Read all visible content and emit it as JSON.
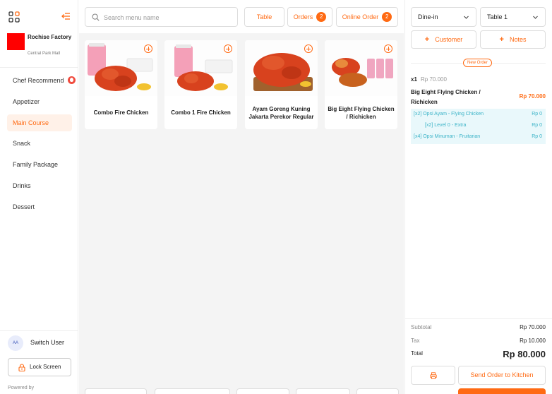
{
  "sidebar": {
    "brand_name": "Rochise Factory",
    "brand_location": "Central Park Mall",
    "categories": [
      {
        "label": "Chef Recommend",
        "active": false,
        "badge": "fire-icon"
      },
      {
        "label": "Appetizer",
        "active": false
      },
      {
        "label": "Main Course",
        "active": true
      },
      {
        "label": "Snack",
        "active": false
      },
      {
        "label": "Family Package",
        "active": false
      },
      {
        "label": "Drinks",
        "active": false
      },
      {
        "label": "Dessert",
        "active": false
      }
    ],
    "user_initials": "AA",
    "switch_user_label": "Switch User",
    "lock_screen_label": "Lock Screen",
    "powered_by": "Powered by"
  },
  "topbar": {
    "search_placeholder": "Search menu name",
    "table_label": "Table",
    "orders_label": "Orders",
    "orders_count": "2",
    "online_order_label": "Online Order",
    "online_order_count": "2"
  },
  "menu": {
    "items": [
      {
        "name": "Combo Fire Chicken"
      },
      {
        "name": "Combo 1 Fire Chicken"
      },
      {
        "name": "Ayam Goreng Kuning Jakarta Perekor Regular"
      },
      {
        "name": "Big Eight Flying Chicken / Richicken"
      }
    ]
  },
  "order": {
    "order_type": "Dine-in",
    "table": "Table 1",
    "customer_label": "Customer",
    "notes_label": "Notes",
    "new_order_label": "New Order",
    "line_items": [
      {
        "qty": "x1",
        "unit_price": "Rp 70.000",
        "name": "Big Eight Flying Chicken / Richicken",
        "total": "Rp 70.000",
        "options": [
          {
            "label": "[x2] Opsi Ayam - Flying Chicken",
            "price": "Rp 0"
          },
          {
            "label": "[x2] Level 0  - Extra",
            "price": "Rp 0"
          },
          {
            "label": "[x4] Opsi Minuman - Fruitarian",
            "price": "Rp 0"
          }
        ]
      }
    ],
    "subtotal_label": "Subtotal",
    "subtotal": "Rp 70.000",
    "tax_label": "Tax",
    "tax": "Rp 10.000",
    "total_label": "Total",
    "total": "Rp 80.000",
    "send_label": "Send Order to Kitchen"
  },
  "colors": {
    "accent": "#ff6a13",
    "option_bg": "#e9f8fb",
    "option_text": "#3bb3c7"
  }
}
